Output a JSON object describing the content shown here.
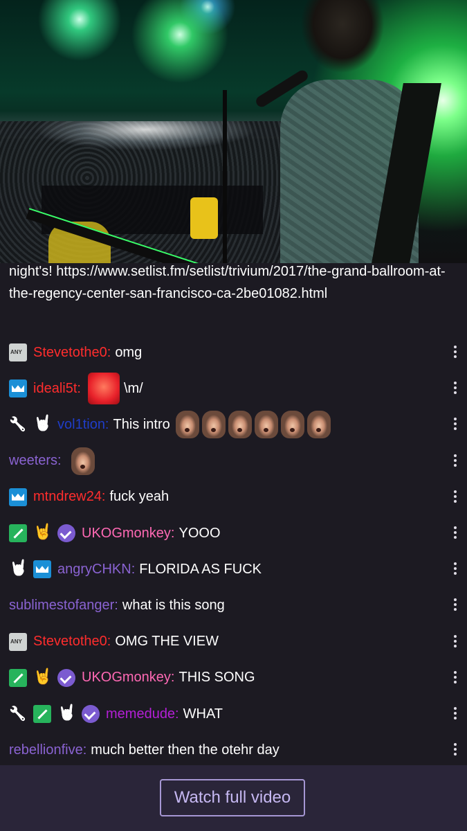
{
  "video": {
    "description_alt": ""
  },
  "chat": {
    "intro_text": "night's! https://www.setlist.fm/setlist/trivium/2017/the-grand-ballroom-at-the-regency-center-san-francisco-ca-2be01082.html",
    "messages": [
      {
        "badges": [
          "any-badge-icon"
        ],
        "username": "Stevetothe0:",
        "color": "#ff2d2d",
        "text": "omg",
        "emotes": 0
      },
      {
        "badges": [
          "crown-icon"
        ],
        "username": "ideali5t:",
        "color": "#ff2d2d",
        "text": "\\m/",
        "emotes": 0,
        "dog_emote": true
      },
      {
        "badges": [
          "wrench-icon",
          "horns-icon"
        ],
        "username": "vol1tion:",
        "color": "#1f3dc9",
        "text": "This intro",
        "emotes": 6
      },
      {
        "badges": [],
        "username": "weeters:",
        "color": "#8a63d2",
        "text": "",
        "emotes": 1
      },
      {
        "badges": [
          "crown-icon"
        ],
        "username": "mtndrew24:",
        "color": "#ff2d2d",
        "text": "fuck yeah",
        "emotes": 0
      },
      {
        "badges": [
          "sword-icon",
          "horns-icon",
          "verified-icon"
        ],
        "username": "UKOGmonkey:",
        "color": "#ff69b4",
        "text": "YOOO",
        "emotes": 0
      },
      {
        "badges": [
          "horns-icon",
          "crown-icon"
        ],
        "username": "angryCHKN:",
        "color": "#8a63d2",
        "text": "FLORIDA AS FUCK",
        "emotes": 0
      },
      {
        "badges": [],
        "username": "sublimestofanger:",
        "color": "#8a63d2",
        "text": "what is this song",
        "emotes": 0
      },
      {
        "badges": [
          "any-badge-icon"
        ],
        "username": "Stevetothe0:",
        "color": "#ff2d2d",
        "text": "OMG THE VIEW",
        "emotes": 0
      },
      {
        "badges": [
          "sword-icon",
          "horns-icon",
          "verified-icon"
        ],
        "username": "UKOGmonkey:",
        "color": "#ff69b4",
        "text": "THIS SONG",
        "emotes": 0
      },
      {
        "badges": [
          "wrench-icon",
          "sword-icon",
          "horns-icon",
          "verified-icon"
        ],
        "username": "memedude:",
        "color": "#b41fd6",
        "text": "WHAT",
        "emotes": 0
      },
      {
        "badges": [],
        "username": "rebellionfive:",
        "color": "#8a63d2",
        "text": "much better then the otehr day",
        "emotes": 0
      }
    ]
  },
  "footer": {
    "watch_label": "Watch full video"
  },
  "colors": {
    "background": "#1c1a22",
    "footer_bg": "#2a2539",
    "button_border": "#a697d4"
  }
}
